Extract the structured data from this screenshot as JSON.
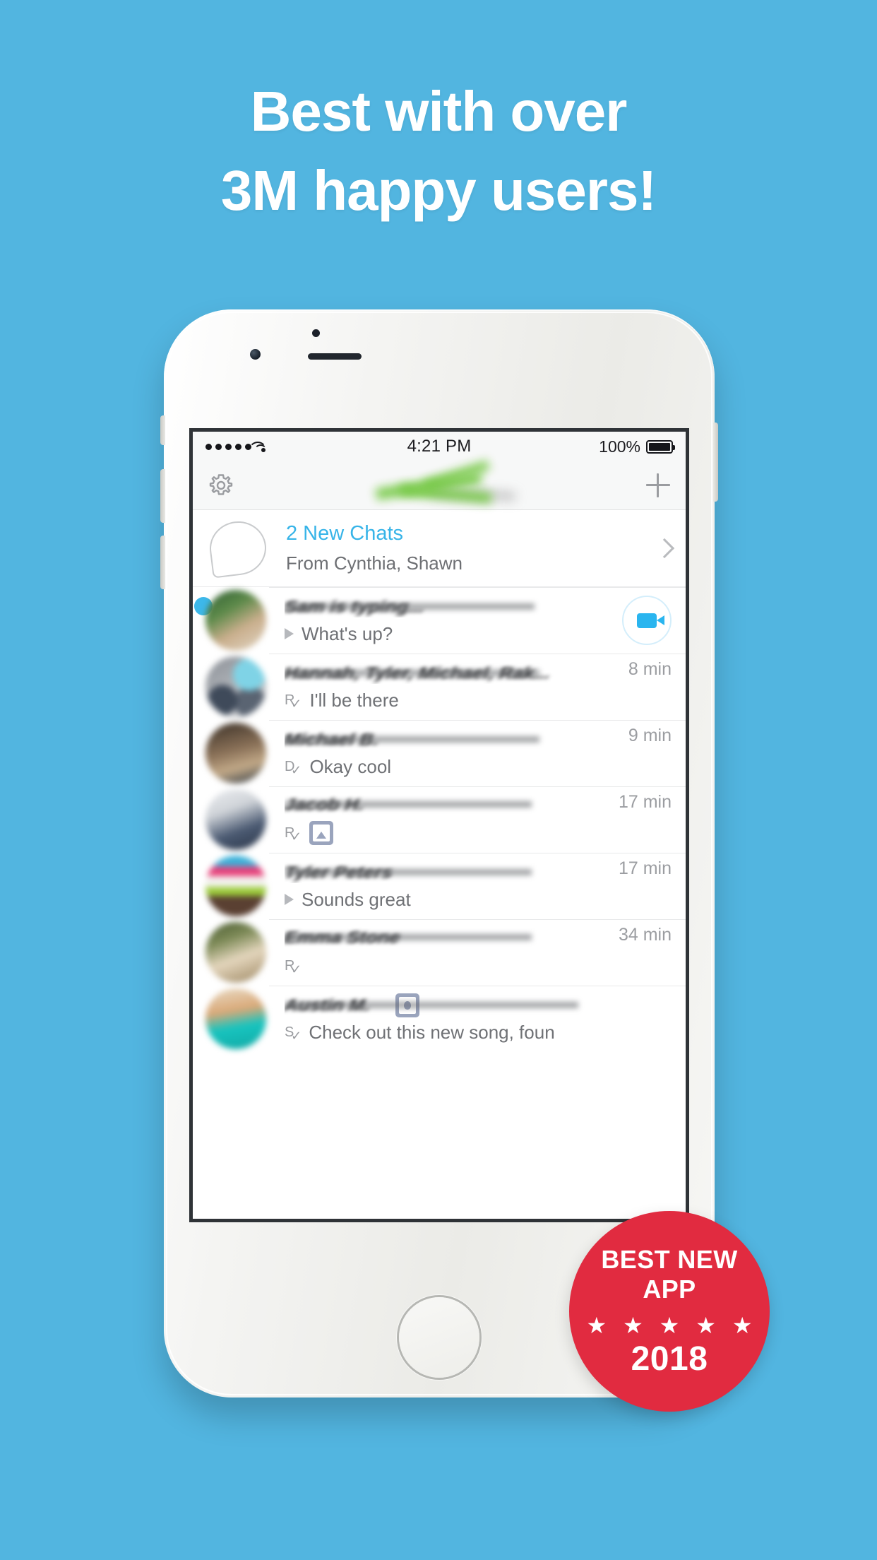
{
  "background_color": "#52b5e0",
  "headline": {
    "line1": "Best  with over",
    "line2": "3M happy users!"
  },
  "phone": {
    "status_bar": {
      "signal": "•••••",
      "wifi_icon": "wifi-icon",
      "time": "4:21 PM",
      "battery_percent": "100%",
      "battery_icon": "battery-full-icon"
    },
    "app_bar": {
      "settings_icon": "gear-icon",
      "logo": "app-logo-blurred",
      "new_chat_icon": "plus-icon"
    },
    "new_chats": {
      "icon": "chat-bubble-icon",
      "title": "2 New Chats",
      "subtitle": "From Cynthia, Shawn",
      "chevron": "chevron-right-icon",
      "title_color": "#37b4e8"
    },
    "conversations": [
      {
        "name": "Sam is typing...",
        "name_blurred": true,
        "preview": "What's up?",
        "preview_icon": "play-triangle-icon",
        "time": "",
        "unread": true,
        "action": "video-call-icon",
        "avatar_colors": [
          "#4e7a4a",
          "#c3a98a",
          "#2f5e33"
        ]
      },
      {
        "name": "Hannah, Tyler, Michael, Rak...",
        "name_blurred": true,
        "preview": "I'll be there",
        "preview_icon": "received-check-icon",
        "time": "8 min",
        "unread": false,
        "action": "",
        "avatar_colors": [
          "#6ec4d8",
          "#8a8f96",
          "#3d4552"
        ]
      },
      {
        "name": "Michael B.",
        "name_blurred": true,
        "preview": "Okay cool",
        "preview_icon": "delivered-check-icon",
        "time": "9 min",
        "unread": false,
        "action": "",
        "avatar_colors": [
          "#8a7158",
          "#40352c",
          "#b89b7d"
        ]
      },
      {
        "name": "Jacob H.",
        "name_blurred": true,
        "preview": "",
        "preview_icon": "received-check-icon",
        "preview_thumb": "image-thumb-icon",
        "time": "17 min",
        "unread": false,
        "action": "",
        "avatar_colors": [
          "#e7e9ec",
          "#4b5a72",
          "#2f3c50"
        ]
      },
      {
        "name": "Tyler Peters",
        "name_blurred": true,
        "preview": "Sounds great",
        "preview_icon": "play-triangle-icon",
        "time": "17 min",
        "unread": false,
        "action": "",
        "avatar_colors": [
          "#3db0d8",
          "#e8407a",
          "#9ccc3a"
        ]
      },
      {
        "name": "Emma Stone",
        "name_blurred": true,
        "preview": "",
        "preview_icon": "received-check-icon",
        "preview_thumb": "camera-thumb-icon",
        "time": "34 min",
        "unread": false,
        "action": "",
        "avatar_colors": [
          "#4a5a33",
          "#d9c49f",
          "#8e7a55"
        ]
      },
      {
        "name": "Austin M.",
        "name_blurred": true,
        "preview": "Check out this new song, foun",
        "preview_icon": "sent-check-icon",
        "time": "",
        "unread": false,
        "action": "",
        "avatar_colors": [
          "#e8d7c0",
          "#17c4bf",
          "#c9956a"
        ]
      }
    ]
  },
  "award_badge": {
    "title": "BEST NEW APP",
    "stars": "★ ★ ★ ★ ★",
    "year": "2018",
    "color": "#e12b40"
  }
}
